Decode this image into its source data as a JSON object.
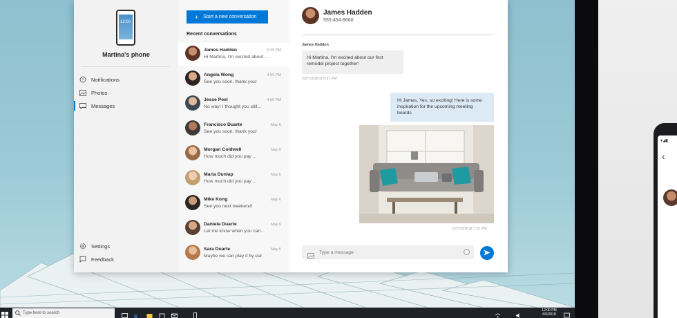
{
  "sidebar": {
    "device_name": "Martina's phone",
    "phone_screen_time": "12:00",
    "items": [
      {
        "label": "Notifications",
        "icon": "bell-icon"
      },
      {
        "label": "Photos",
        "icon": "photo-icon"
      },
      {
        "label": "Messages",
        "icon": "message-icon",
        "active": true
      }
    ],
    "bottom_items": [
      {
        "label": "Settings",
        "icon": "gear-icon"
      },
      {
        "label": "Feedback",
        "icon": "feedback-icon"
      }
    ]
  },
  "conversations": {
    "new_button_label": "Start a new conversation",
    "recent_label": "Recent conversations",
    "items": [
      {
        "name": "James Hadden",
        "preview": "Hi Martina, I'm excited about ...",
        "date": "6:39 PM",
        "selected": true
      },
      {
        "name": "Angela Wong",
        "preview": "See you soon, thank you!",
        "date": "4:59 PM"
      },
      {
        "name": "Jesse Peel",
        "preview": "No way! I thought you still...",
        "date": "4:55 PM"
      },
      {
        "name": "Francisco Duarte",
        "preview": "See you soon, thank you!",
        "date": "May 6"
      },
      {
        "name": "Morgan Coldwell",
        "preview": "How much did you pay ...",
        "date": "May 6"
      },
      {
        "name": "Maria Dunlap",
        "preview": "How much did you pay ...",
        "date": "May 6"
      },
      {
        "name": "Mike Kong",
        "preview": "See you next weekend!",
        "date": "May 6"
      },
      {
        "name": "Daniela Duarte",
        "preview": "Let me know when you can...",
        "date": "May 6"
      },
      {
        "name": "Sara Duarte",
        "preview": "Maybe we can play it by ear.",
        "date": "May 5"
      }
    ]
  },
  "chat": {
    "contact_name": "James Hadden",
    "contact_number": "555-454-8666",
    "sender_label": "James Hadden",
    "incoming_message": "Hi Martina, I'm excited about our first remodel project together!",
    "incoming_time": "2/27/2018 at 6:37 PM",
    "outgoing_message": "Hi James, Yes, so exciting! Here is some inspiration for the upcoming meeting boards",
    "outgoing_time": "2/27/2018 at 7:15 PM",
    "composer_placeholder": "Type a message"
  },
  "taskbar": {
    "search_placeholder": "Type here to search",
    "time": "12:00 PM",
    "date": "6/5/2018"
  },
  "colors": {
    "accent": "#0078d7",
    "sidebar_bg": "#f2f2f2",
    "list_bg": "#f7f7f7",
    "outgoing_bubble": "#dceaf6"
  }
}
